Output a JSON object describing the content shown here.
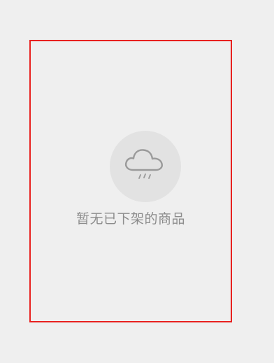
{
  "empty_state": {
    "icon": "cloud-rain-icon",
    "message": "暂无已下架的商品"
  },
  "colors": {
    "background": "#efefef",
    "frame": "#e8211f",
    "icon_circle": "#e2e2e2",
    "icon_stroke": "#9a9a9a",
    "text": "#8c8c8c"
  }
}
